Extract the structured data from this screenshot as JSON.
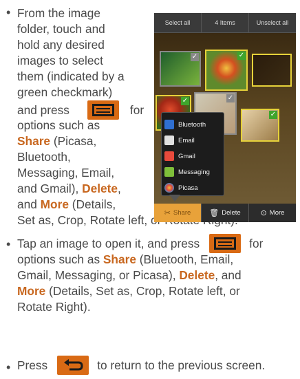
{
  "bullets": [
    {
      "lines": [
        "From the image",
        "folder, touch and",
        "hold any desired",
        "images to select",
        "them (indicated by a",
        "green checkmark)",
        "and press",
        "for",
        "options such as",
        "Share",
        "(Picasa,",
        "Bluetooth,",
        "Messaging, Email,",
        "and Gmail),",
        "Delete",
        ",",
        "and",
        "More",
        "(Details,",
        "Set as, Crop, Rotate left, or Rotate Right)."
      ]
    },
    {
      "lines": [
        "Tap an image to open it, and press",
        "for",
        "options such as",
        "Share",
        "(Bluetooth, Email,",
        "Gmail, Messaging, or Picasa),",
        "Delete",
        ", and",
        "More",
        "(Details, Set as, Crop, Rotate left, or",
        "Rotate Right)."
      ]
    },
    {
      "lines": [
        "Press",
        "to return to the previous screen."
      ]
    }
  ],
  "screenshot": {
    "top_bar": [
      "Select all",
      "4 Items",
      "Unselect all"
    ],
    "popup_items": [
      "Bluetooth",
      "Email",
      "Gmail",
      "Messaging",
      "Picasa"
    ],
    "bottom_bar": [
      "Share",
      "Delete",
      "More"
    ]
  },
  "colors": {
    "accent": "#c8671f",
    "key": "#d96a14",
    "check": "#3fa52c"
  },
  "icons": [
    "menu-key-icon",
    "back-key-icon",
    "check-icon",
    "bluetooth-icon",
    "email-icon",
    "gmail-icon",
    "messaging-icon",
    "picasa-icon",
    "share-icon",
    "trash-icon",
    "more-icon"
  ]
}
